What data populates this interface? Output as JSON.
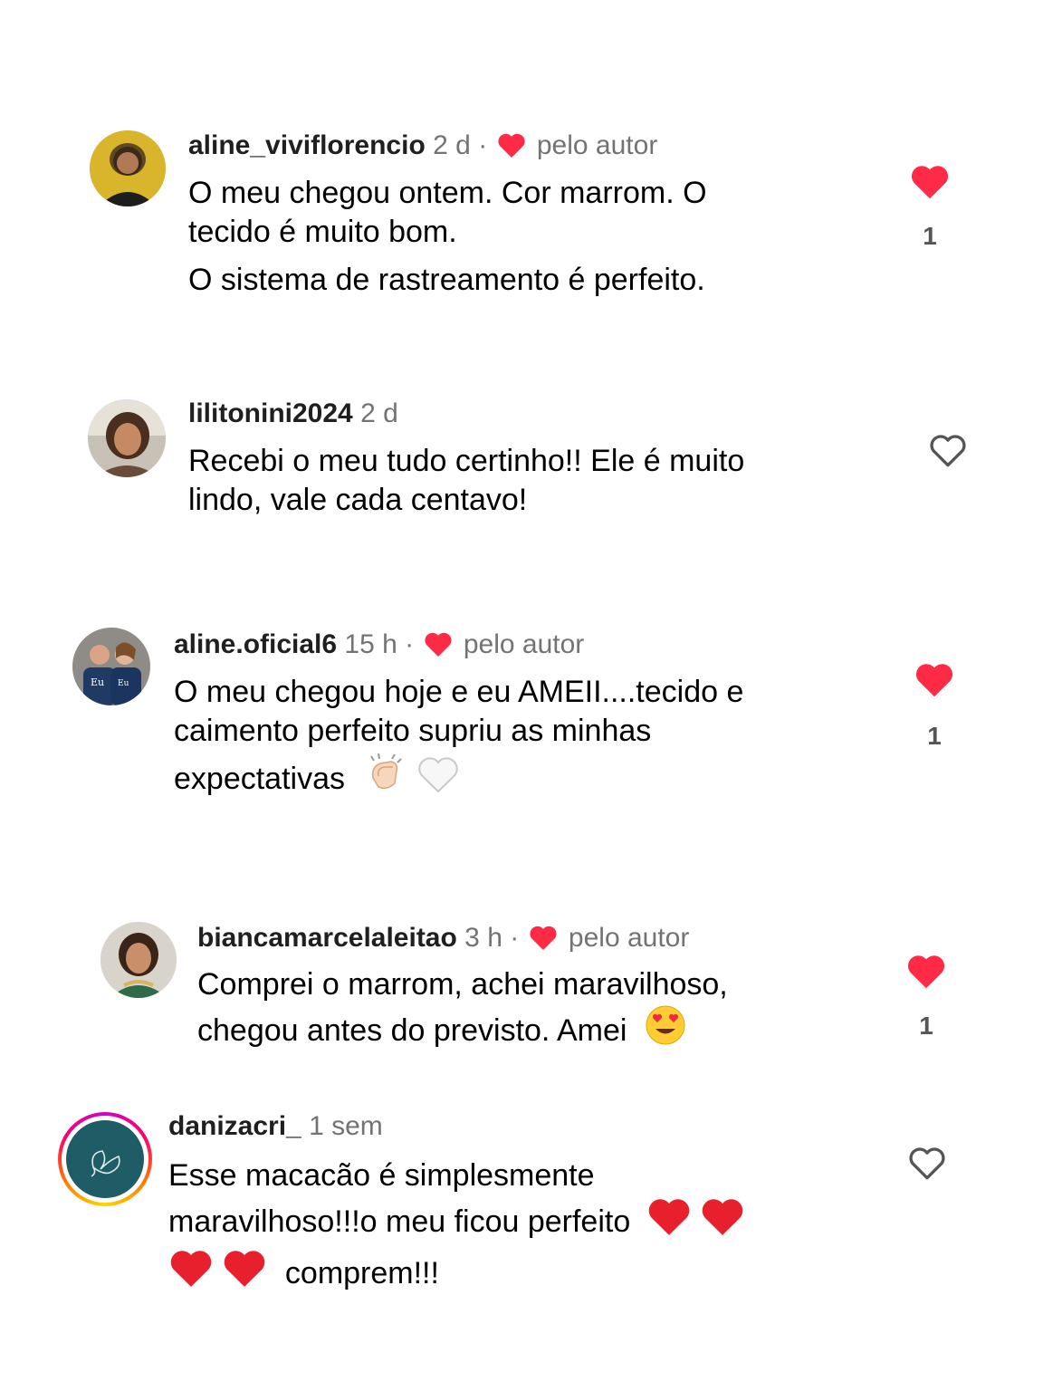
{
  "comments": [
    {
      "username": "aline_viviflorencio",
      "time": "2 d",
      "author_liked": true,
      "author_label": "pelo autor",
      "lines": [
        "O meu chegou ontem. Cor marrom. O",
        "tecido é muito bom."
      ],
      "extra_line": "O sistema de rastreamento é perfeito.",
      "liked": true,
      "like_count": "1"
    },
    {
      "username": "lilitonini2024",
      "time": "2 d",
      "author_liked": false,
      "lines": [
        "Recebi o meu tudo certinho!! Ele é muito",
        "lindo, vale cada centavo!"
      ],
      "liked": false
    },
    {
      "username": "aline.oficial6",
      "time": "15 h",
      "author_liked": true,
      "author_label": "pelo autor",
      "lines": [
        "O meu chegou hoje e eu AMEII....tecido e",
        "caimento perfeito supriu as minhas",
        "expectativas"
      ],
      "emojis": [
        "clapping-hands",
        "white-heart"
      ],
      "liked": true,
      "like_count": "1"
    },
    {
      "username": "biancamarcelaleitao",
      "time": "3 h",
      "author_liked": true,
      "author_label": "pelo autor",
      "lines": [
        "Comprei o marrom, achei maravilhoso,",
        "chegou antes do previsto. Amei"
      ],
      "emojis": [
        "heart-eyes"
      ],
      "liked": true,
      "like_count": "1"
    },
    {
      "username": "danizacri_",
      "time": "1 sem",
      "author_liked": false,
      "lines": [
        "Esse macacão é simplesmente",
        "maravilhoso!!!o meu ficou perfeito",
        "comprem!!!"
      ],
      "emojis": [
        "red-heart",
        "red-heart",
        "red-heart",
        "red-heart"
      ],
      "liked": false,
      "has_story_ring": true
    }
  ],
  "colors": {
    "like_red": "#ff2a45",
    "secondary_text": "#737373",
    "username": "#1f1f1f"
  }
}
